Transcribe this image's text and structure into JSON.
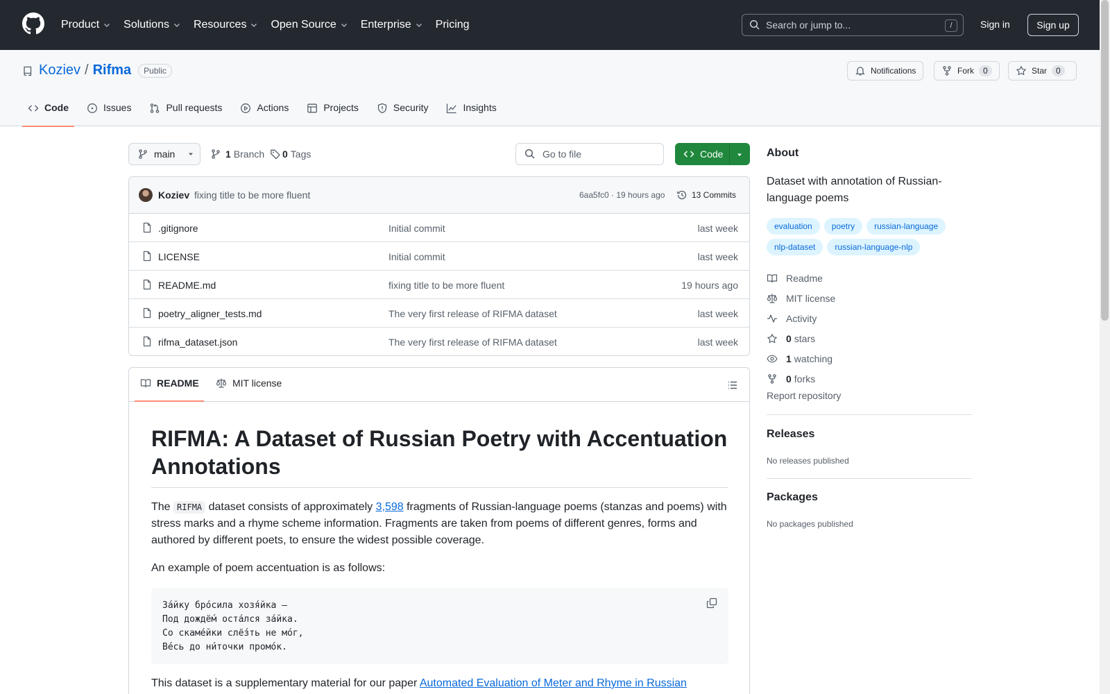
{
  "topbar": {
    "nav": [
      "Product",
      "Solutions",
      "Resources",
      "Open Source",
      "Enterprise",
      "Pricing"
    ],
    "search_placeholder": "Search or jump to...",
    "search_key": "/",
    "signin": "Sign in",
    "signup": "Sign up"
  },
  "repo": {
    "owner": "Koziev",
    "separator": "/",
    "name": "Rifma",
    "visibility": "Public",
    "notifications": "Notifications",
    "fork_label": "Fork",
    "fork_count": "0",
    "star_label": "Star",
    "star_count": "0"
  },
  "tabs": [
    "Code",
    "Issues",
    "Pull requests",
    "Actions",
    "Projects",
    "Security",
    "Insights"
  ],
  "toolbar": {
    "branch": "main",
    "branch_count": "1",
    "branch_label": "Branch",
    "tag_count": "0",
    "tag_label": "Tags",
    "gofile_placeholder": "Go to file",
    "code_button": "Code"
  },
  "commit": {
    "author": "Koziev",
    "message": "fixing title to be more fluent",
    "meta": "6aa5fc0 · 19 hours ago",
    "count": "13 Commits"
  },
  "files": [
    {
      "name": ".gitignore",
      "message": "Initial commit",
      "date": "last week"
    },
    {
      "name": "LICENSE",
      "message": "Initial commit",
      "date": "last week"
    },
    {
      "name": "README.md",
      "message": "fixing title to be more fluent",
      "date": "19 hours ago"
    },
    {
      "name": "poetry_aligner_tests.md",
      "message": "The very first release of RIFMA dataset",
      "date": "last week"
    },
    {
      "name": "rifma_dataset.json",
      "message": "The very first release of RIFMA dataset",
      "date": "last week"
    }
  ],
  "readme": {
    "tab_readme": "README",
    "tab_license": "MIT license",
    "title": "RIFMA: A Dataset of Russian Poetry with Accentuation Annotations",
    "p1_a": "The ",
    "p1_code": "RIFMA",
    "p1_b": " dataset consists of approximately ",
    "p1_link": "3,598",
    "p1_c": " fragments of Russian-language poems (stanzas and poems) with stress marks and a rhyme scheme information. Fragments are taken from poems of different genres, forms and authored by different poets, to ensure the widest possible coverage.",
    "p2": "An example of poem accentuation is as follows:",
    "poem": "За́йку бро́сила хозя́йка —\nПод дождё́м оста́лся за́йка.\nСо скаме́йки слё́зть не мо́г,\nВе́сь до ни́точки промо́к.",
    "p3_a": "This dataset is a supplementary material for our paper ",
    "p3_link": "Automated Evaluation of Meter and Rhyme in Russian"
  },
  "sidebar": {
    "about": "About",
    "description": "Dataset with annotation of Russian-language poems",
    "topics": [
      "evaluation",
      "poetry",
      "russian-language",
      "nlp-dataset",
      "russian-language-nlp"
    ],
    "readme": "Readme",
    "license": "MIT license",
    "activity": "Activity",
    "stars_count": "0",
    "stars_label": "stars",
    "watching_count": "1",
    "watching_label": "watching",
    "forks_count": "0",
    "forks_label": "forks",
    "report": "Report repository",
    "releases": "Releases",
    "releases_note": "No releases published",
    "packages": "Packages",
    "packages_note": "No packages published"
  },
  "colors": {
    "header_bg": "#24292f",
    "link": "#0969da",
    "code_button": "#1f883d",
    "tab_underline": "#fd8c73",
    "topic_bg": "#ddf4ff"
  }
}
